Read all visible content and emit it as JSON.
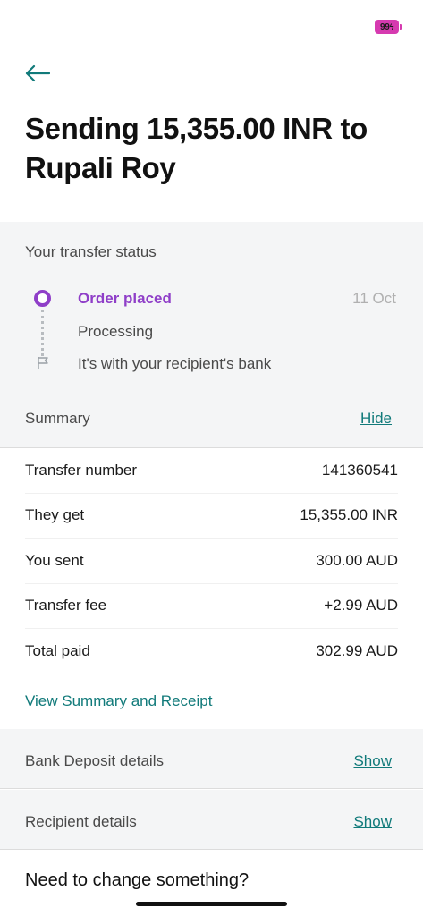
{
  "status_bar": {
    "battery": "99"
  },
  "header": {
    "title_line1": "Sending 15,355.00 INR to",
    "title_line2": "Rupali Roy"
  },
  "transfer_status": {
    "heading": "Your transfer status",
    "steps": [
      {
        "label": "Order placed",
        "date": "11 Oct",
        "state": "active"
      },
      {
        "label": "Processing",
        "state": "pending"
      },
      {
        "label": "It's with your recipient's bank",
        "state": "pending"
      }
    ]
  },
  "summary": {
    "heading": "Summary",
    "toggle_label": "Hide",
    "rows": [
      {
        "label": "Transfer number",
        "value": "141360541"
      },
      {
        "label": "They get",
        "value": "15,355.00 INR"
      },
      {
        "label": "You sent",
        "value": "300.00 AUD"
      },
      {
        "label": "Transfer fee",
        "value": "+2.99 AUD"
      },
      {
        "label": "Total paid",
        "value": "302.99 AUD"
      }
    ],
    "receipt_link": "View Summary and Receipt"
  },
  "bank_deposit": {
    "label": "Bank Deposit details",
    "toggle_label": "Show"
  },
  "recipient": {
    "label": "Recipient details",
    "toggle_label": "Show"
  },
  "change": {
    "heading": "Need to change something?"
  },
  "colors": {
    "accent_purple": "#8f3ec8",
    "link_teal": "#117a7a",
    "section_bg": "#f4f5f6",
    "battery": "#d63ab0"
  }
}
